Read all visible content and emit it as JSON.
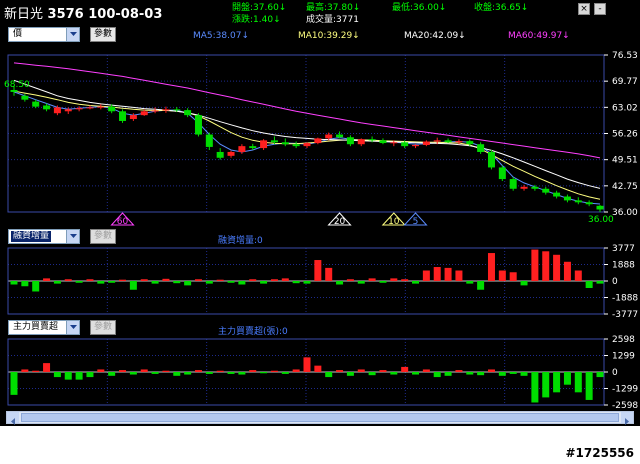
{
  "header": {
    "stock_name": "新日光",
    "stock_code": "3576",
    "date": "100-08-03",
    "quote": {
      "open_label": "開盤:",
      "open_value": "37.60↓",
      "high_label": "最高:",
      "high_value": "37.80↓",
      "low_label": "最低:",
      "low_value": "36.00↓",
      "close_label": "收盤:",
      "close_value": "36.65↓",
      "change_label": "漲跌:",
      "change_value": "1.40↓",
      "volume_label": "成交量:",
      "volume_value": "3771"
    },
    "window_buttons": {
      "close": "×",
      "minimize": "-"
    }
  },
  "price_panel": {
    "selector_value": "價",
    "param_button": "參數",
    "ma_labels": [
      {
        "text": "MA5:38.07↓",
        "color": "#5b8cff"
      },
      {
        "text": "MA10:39.29↓",
        "color": "#ffff80"
      },
      {
        "text": "MA20:42.09↓",
        "color": "#ffffff"
      },
      {
        "text": "MA60:49.97↓",
        "color": "#ff40ff"
      }
    ],
    "max_label": "68.50",
    "min_label": "36.00",
    "y_ticks": [
      "76.53",
      "69.77",
      "63.02",
      "56.26",
      "49.51",
      "42.75",
      "36.00"
    ],
    "markers": [
      {
        "label": "60",
        "color": "#ff40ff",
        "idx": 10
      },
      {
        "label": "20",
        "color": "#ffffff",
        "idx": 30
      },
      {
        "label": "10",
        "color": "#ffff80",
        "idx": 35
      },
      {
        "label": "5",
        "color": "#5b8cff",
        "idx": 37
      }
    ]
  },
  "margin_panel": {
    "selector_value": "融資增量",
    "param_button": "參數",
    "title": "融資增量:0",
    "y_ticks": [
      "3777",
      "1888",
      "0",
      "-1888",
      "-3777"
    ]
  },
  "main_force_panel": {
    "selector_value": "主力買賣超",
    "param_button": "參數",
    "title": "主力買賣超(張):0",
    "y_ticks": [
      "2598",
      "1299",
      "0",
      "-1299",
      "-2598"
    ]
  },
  "watermark": "#1725556",
  "colors": {
    "up": "#ff2020",
    "down": "#00dd00",
    "grid": "#1e2a8c",
    "axis_text": "#ffffff"
  },
  "chart_data": [
    {
      "type": "candlestick",
      "ylim": [
        36.0,
        76.53
      ],
      "candles": [
        [
          67.5,
          68.5,
          66.0,
          67.0
        ],
        [
          66.0,
          66.5,
          64.5,
          65.0
        ],
        [
          64.5,
          65.0,
          62.8,
          63.2
        ],
        [
          63.5,
          64.0,
          62.0,
          62.5
        ],
        [
          61.5,
          63.5,
          61.0,
          63.0
        ],
        [
          62.0,
          63.0,
          61.3,
          62.5
        ],
        [
          62.5,
          63.3,
          62.0,
          62.8
        ],
        [
          62.8,
          63.5,
          62.5,
          63.0
        ],
        [
          63.0,
          63.8,
          62.5,
          63.2
        ],
        [
          63.2,
          63.8,
          61.5,
          62.0
        ],
        [
          62.0,
          62.5,
          59.0,
          59.5
        ],
        [
          60.0,
          61.5,
          59.5,
          61.0
        ],
        [
          61.0,
          62.5,
          60.8,
          62.0
        ],
        [
          62.0,
          63.0,
          61.5,
          62.2
        ],
        [
          62.2,
          63.2,
          61.6,
          62.5
        ],
        [
          62.5,
          63.1,
          61.8,
          62.3
        ],
        [
          62.3,
          62.8,
          60.5,
          61.0
        ],
        [
          61.0,
          61.5,
          55.5,
          56.0
        ],
        [
          56.0,
          56.5,
          52.0,
          52.8
        ],
        [
          51.5,
          52.5,
          49.5,
          50.0
        ],
        [
          50.5,
          51.8,
          50.0,
          51.5
        ],
        [
          51.5,
          53.5,
          51.0,
          53.0
        ],
        [
          53.0,
          53.6,
          52.0,
          52.5
        ],
        [
          52.5,
          54.8,
          52.0,
          54.5
        ],
        [
          54.5,
          55.5,
          53.5,
          54.0
        ],
        [
          54.0,
          55.0,
          53.0,
          53.5
        ],
        [
          53.5,
          54.2,
          52.5,
          53.0
        ],
        [
          53.0,
          54.0,
          52.5,
          53.8
        ],
        [
          53.8,
          55.2,
          53.5,
          55.0
        ],
        [
          55.0,
          56.5,
          54.5,
          56.0
        ],
        [
          56.0,
          56.8,
          55.0,
          55.3
        ],
        [
          55.3,
          55.8,
          53.0,
          53.5
        ],
        [
          53.5,
          55.0,
          53.0,
          54.8
        ],
        [
          54.8,
          55.5,
          54.0,
          54.5
        ],
        [
          54.5,
          55.0,
          53.5,
          53.8
        ],
        [
          53.8,
          54.5,
          53.0,
          54.0
        ],
        [
          54.0,
          54.5,
          52.5,
          53.0
        ],
        [
          53.0,
          53.5,
          52.5,
          53.3
        ],
        [
          53.3,
          54.5,
          53.0,
          54.2
        ],
        [
          54.2,
          55.2,
          53.5,
          54.5
        ],
        [
          54.5,
          55.0,
          53.8,
          54.0
        ],
        [
          54.0,
          54.8,
          53.5,
          54.3
        ],
        [
          54.3,
          54.8,
          53.0,
          53.5
        ],
        [
          53.5,
          54.0,
          51.0,
          51.5
        ],
        [
          51.5,
          52.0,
          47.0,
          47.5
        ],
        [
          47.5,
          48.0,
          44.0,
          44.5
        ],
        [
          44.5,
          45.0,
          41.5,
          42.0
        ],
        [
          42.0,
          43.0,
          41.5,
          42.5
        ],
        [
          42.5,
          43.0,
          41.5,
          42.0
        ],
        [
          42.0,
          42.5,
          40.5,
          41.0
        ],
        [
          41.0,
          41.5,
          39.5,
          40.0
        ],
        [
          40.0,
          40.5,
          38.5,
          39.0
        ],
        [
          39.0,
          39.8,
          38.0,
          38.5
        ],
        [
          38.5,
          39.0,
          37.5,
          38.0
        ],
        [
          37.6,
          37.8,
          36.0,
          36.65
        ]
      ],
      "ma5": [
        67.0,
        66.0,
        65.0,
        64.0,
        63.0,
        62.5,
        62.8,
        63.0,
        63.2,
        62.8,
        61.5,
        61.0,
        61.5,
        62.0,
        62.3,
        62.3,
        61.5,
        59.0,
        56.0,
        53.5,
        52.0,
        51.5,
        52.0,
        53.0,
        53.5,
        53.8,
        53.7,
        53.5,
        54.0,
        54.8,
        55.2,
        54.8,
        54.6,
        54.5,
        54.2,
        54.0,
        53.8,
        53.5,
        53.6,
        53.9,
        54.1,
        54.2,
        54.0,
        53.0,
        51.0,
        48.0,
        45.0,
        43.5,
        42.5,
        41.5,
        40.5,
        39.5,
        38.8,
        38.3,
        38.07
      ],
      "ma10": [
        67.2,
        66.7,
        66.2,
        65.6,
        65.0,
        64.3,
        63.8,
        63.5,
        63.3,
        63.1,
        62.8,
        62.5,
        62.3,
        62.2,
        62.2,
        62.0,
        61.6,
        60.8,
        59.5,
        58.0,
        56.5,
        55.3,
        54.5,
        54.0,
        53.7,
        53.6,
        53.6,
        53.8,
        54.0,
        54.3,
        54.5,
        54.6,
        54.6,
        54.5,
        54.4,
        54.3,
        54.2,
        54.1,
        54.0,
        54.0,
        53.9,
        53.8,
        53.3,
        52.3,
        50.8,
        49.3,
        47.8,
        46.5,
        45.2,
        44.0,
        42.8,
        41.7,
        40.7,
        39.9,
        39.29
      ],
      "ma20": [
        70.0,
        69.0,
        68.0,
        67.0,
        66.0,
        65.3,
        64.8,
        64.3,
        63.9,
        63.6,
        63.3,
        63.0,
        62.7,
        62.5,
        62.3,
        62.0,
        61.6,
        61.0,
        60.2,
        59.3,
        58.5,
        57.7,
        57.0,
        56.4,
        55.9,
        55.5,
        55.2,
        55.0,
        54.8,
        54.7,
        54.6,
        54.5,
        54.4,
        54.3,
        54.2,
        54.1,
        54.0,
        53.9,
        53.8,
        53.7,
        53.6,
        53.4,
        53.1,
        52.6,
        51.9,
        51.0,
        50.0,
        48.9,
        47.8,
        46.7,
        45.6,
        44.5,
        43.6,
        42.8,
        42.09
      ],
      "ma60": [
        74.5,
        74.2,
        73.9,
        73.6,
        73.3,
        73.0,
        72.6,
        72.2,
        71.8,
        71.4,
        71.0,
        70.5,
        70.0,
        69.5,
        69.0,
        68.5,
        68.0,
        67.4,
        66.8,
        66.2,
        65.6,
        65.0,
        64.4,
        63.8,
        63.2,
        62.6,
        62.0,
        61.5,
        61.0,
        60.5,
        60.0,
        59.5,
        59.0,
        58.6,
        58.2,
        57.8,
        57.4,
        57.0,
        56.6,
        56.2,
        55.8,
        55.4,
        55.0,
        54.6,
        54.2,
        53.8,
        53.4,
        53.0,
        52.6,
        52.2,
        51.8,
        51.4,
        51.0,
        50.5,
        49.97
      ]
    },
    {
      "type": "bar",
      "ylim": [
        -3777,
        3777
      ],
      "values": [
        -400,
        -600,
        -1200,
        300,
        -300,
        200,
        -200,
        200,
        -300,
        -200,
        150,
        -1000,
        200,
        -300,
        250,
        -250,
        -500,
        200,
        -300,
        150,
        -200,
        -400,
        200,
        -300,
        200,
        300,
        -250,
        -300,
        2400,
        1500,
        -400,
        200,
        -300,
        300,
        -200,
        300,
        200,
        -300,
        1200,
        1600,
        1500,
        1200,
        -300,
        -1000,
        3200,
        1200,
        1000,
        -500,
        3600,
        3400,
        3000,
        2200,
        1200,
        -800,
        -300
      ]
    },
    {
      "type": "bar",
      "ylim": [
        -2598,
        2598
      ],
      "values": [
        -1800,
        200,
        100,
        700,
        -400,
        -600,
        -600,
        -400,
        200,
        -300,
        150,
        -200,
        200,
        -150,
        100,
        -300,
        -200,
        150,
        -150,
        100,
        -150,
        -200,
        150,
        -100,
        100,
        -150,
        200,
        1150,
        500,
        -400,
        150,
        -300,
        200,
        -250,
        150,
        -200,
        400,
        -200,
        200,
        -400,
        -300,
        150,
        -200,
        -250,
        200,
        -300,
        -150,
        -300,
        -2400,
        -2000,
        -1600,
        -1000,
        -1600,
        -2200,
        -400
      ]
    }
  ]
}
